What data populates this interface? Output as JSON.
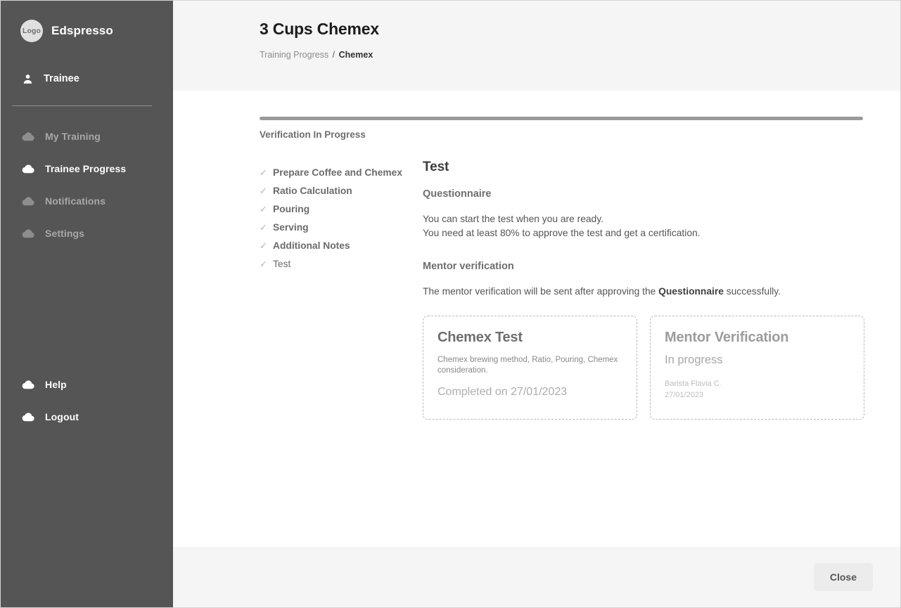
{
  "sidebar": {
    "brand": {
      "logo_text": "Logo",
      "name": "Edspresso"
    },
    "user": {
      "label": "Trainee",
      "icon": "person-icon"
    },
    "nav": [
      {
        "label": "My Training",
        "icon": "cloud-icon",
        "active": false
      },
      {
        "label": "Trainee Progress",
        "icon": "cloud-icon",
        "active": true
      },
      {
        "label": "Notifications",
        "icon": "cloud-icon",
        "active": false
      },
      {
        "label": "Settings",
        "icon": "cloud-icon",
        "active": false
      }
    ],
    "nav_bottom": [
      {
        "label": "Help",
        "icon": "cloud-icon",
        "active": true
      },
      {
        "label": "Logout",
        "icon": "cloud-icon",
        "active": true
      }
    ]
  },
  "header": {
    "title": "3 Cups Chemex",
    "breadcrumb": {
      "parent": "Training Progress",
      "separator": "/",
      "current": "Chemex"
    }
  },
  "progress": {
    "label": "Verification In Progress",
    "percent": 100
  },
  "checklist": [
    {
      "label": "Prepare Coffee and Chemex",
      "mark": "✓",
      "complete": true
    },
    {
      "label": "Ratio Calculation",
      "mark": "✓",
      "complete": true
    },
    {
      "label": "Pouring",
      "mark": "✓",
      "complete": true
    },
    {
      "label": "Serving",
      "mark": "✓",
      "complete": true
    },
    {
      "label": "Additional Notes",
      "mark": "✓",
      "complete": true
    },
    {
      "label": "Test",
      "mark": "✓",
      "complete": false
    }
  ],
  "detail": {
    "title": "Test",
    "questionnaire_heading": "Questionnaire",
    "questionnaire_line1": "You can start the test when you are ready.",
    "questionnaire_line2": "You need at least 80% to approve the test and get a certification.",
    "mentor_heading": "Mentor verification",
    "mentor_text_before": "The mentor verification will be sent after approving the ",
    "mentor_text_bold": "Questionnaire",
    "mentor_text_after": " successfully."
  },
  "cards": [
    {
      "id": "chemex-test",
      "title": "Chemex Test",
      "description": "Chemex brewing method, Ratio, Pouring, Chemex consideration.",
      "status": "Completed on 27/01/2023"
    },
    {
      "id": "mentor-verification",
      "title": "Mentor Verification",
      "status": "In progress",
      "meta_name": "Barista Flavia C.",
      "meta_date": "27/01/2023"
    }
  ],
  "footer": {
    "close_label": "Close"
  },
  "colors": {
    "sidebar_bg": "#555555",
    "panel_bg": "#f5f5f5",
    "progress_fill": "#9a9a9a",
    "accent_text": "#6e6e6e"
  }
}
